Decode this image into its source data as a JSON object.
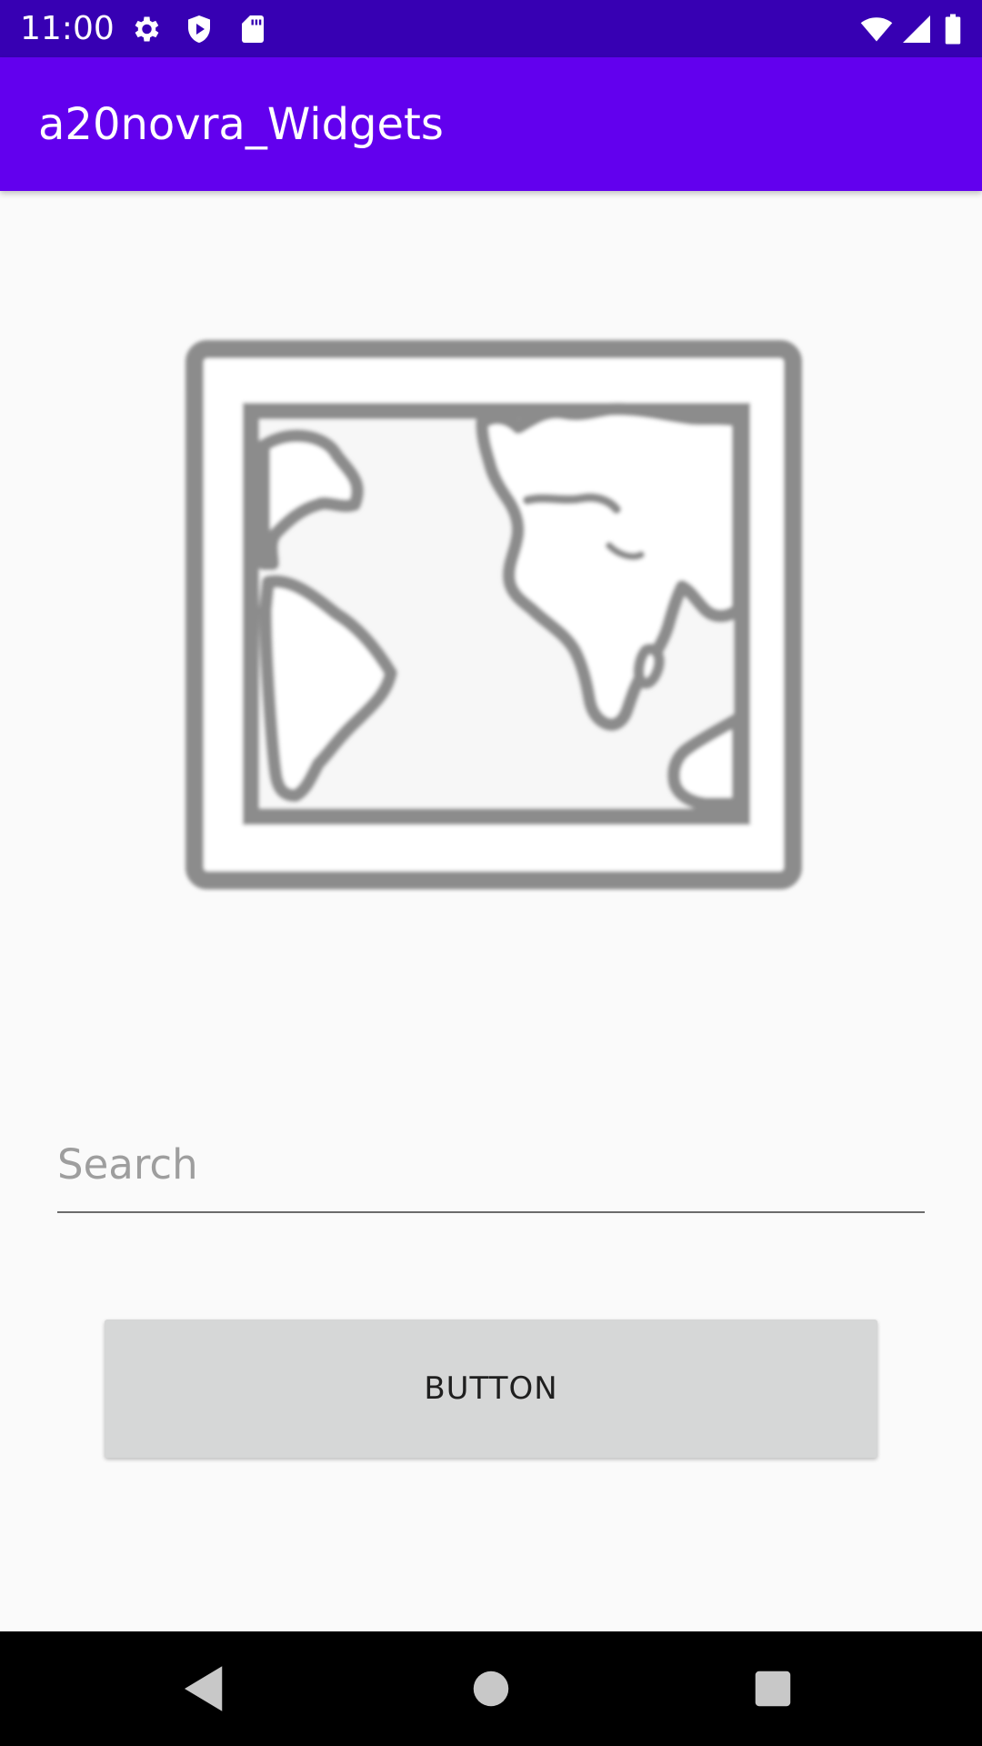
{
  "status_bar": {
    "time": "11:00",
    "background": "#3700b3",
    "left_icons": [
      "gear-icon",
      "shield-icon",
      "sd-card-icon"
    ],
    "right_icons": [
      "wifi-icon",
      "signal-icon",
      "battery-icon"
    ]
  },
  "app_bar": {
    "title": "a20novra_Widgets",
    "background": "#6200ee"
  },
  "image": {
    "icon": "world-map-icon"
  },
  "search": {
    "placeholder": "Search",
    "value": ""
  },
  "button": {
    "label": "BUTTON"
  },
  "nav_bar": {
    "buttons": [
      "back-icon",
      "home-icon",
      "recents-icon"
    ]
  }
}
